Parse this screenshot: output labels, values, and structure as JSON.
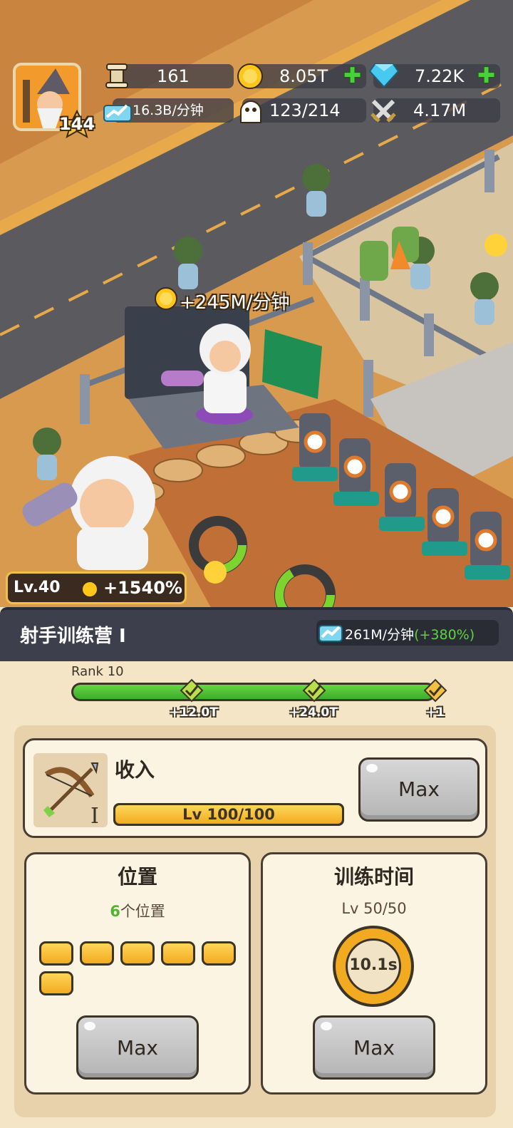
{
  "hud": {
    "player_level": "144",
    "trophies": "161",
    "coins": "8.05T",
    "gems": "7.22K",
    "income_rate": "16.3B/分钟",
    "population": "123/214",
    "power": "4.17M"
  },
  "scene": {
    "floating_income": "+245M/分钟",
    "manager_level": "Lv.40",
    "manager_boost": "+1540%"
  },
  "panel": {
    "title": "射手训练营 I",
    "rate": "261M/分钟",
    "rate_bonus": "(+380%)",
    "rank_label": "Rank 10",
    "rank_progress": 1.0,
    "rewards": [
      "+12.0T",
      "+24.0T",
      "+1"
    ],
    "income": {
      "title": "收入",
      "level_text": "Lv 100/100",
      "level_progress": 1.0,
      "button": "Max"
    },
    "positions": {
      "title": "位置",
      "count": "6",
      "count_suffix": "个位置",
      "slots": 6,
      "button": "Max"
    },
    "training_time": {
      "title": "训练时间",
      "level_text": "Lv 50/50",
      "time": "10.1s",
      "button": "Max"
    }
  },
  "colors": {
    "panel_bg": "#f4e5c6",
    "header_bg": "#3d404c",
    "progress_green": "#4cbf33",
    "gold": "#f2ab20",
    "bonus_green": "#5ed240"
  }
}
